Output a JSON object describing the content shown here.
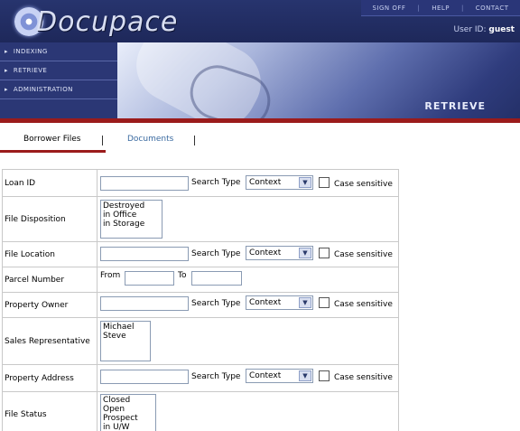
{
  "app": {
    "logo_text": "Docupace",
    "user_label": "User ID:",
    "user_value": "guest"
  },
  "top_links": [
    "SIGN OFF",
    "HELP",
    "CONTACT"
  ],
  "nav": {
    "items": [
      "INDEXING",
      "RETRIEVE",
      "ADMINISTRATION"
    ]
  },
  "banner": {
    "title": "RETRIEVE"
  },
  "tabs": {
    "borrower_files": "Borrower Files",
    "documents": "Documents",
    "separator": "|"
  },
  "labels": {
    "search_type": "Search Type",
    "case_sensitive": "Case sensitive",
    "from": "From",
    "to": "To"
  },
  "form": {
    "loan_id": {
      "label": "Loan ID",
      "value": "",
      "search_type": "Context"
    },
    "file_disposition": {
      "label": "File Disposition",
      "options": [
        "Destroyed",
        "in Office",
        "in Storage"
      ]
    },
    "file_location": {
      "label": "File Location",
      "value": "",
      "search_type": "Context"
    },
    "parcel_number": {
      "label": "Parcel Number",
      "from": "",
      "to": ""
    },
    "property_owner": {
      "label": "Property Owner",
      "value": "",
      "search_type": "Context"
    },
    "sales_representative": {
      "label": "Sales Representative",
      "options": [
        "Michael",
        "Steve"
      ]
    },
    "property_address": {
      "label": "Property Address",
      "value": "",
      "search_type": "Context"
    },
    "file_status": {
      "label": "File Status",
      "options": [
        "Closed",
        "Open",
        "Prospect",
        "in U/W"
      ]
    }
  },
  "colors": {
    "header_bg": "#1f2a5c",
    "accent_red": "#9b1b1b",
    "link_blue": "#3a6aa0"
  }
}
